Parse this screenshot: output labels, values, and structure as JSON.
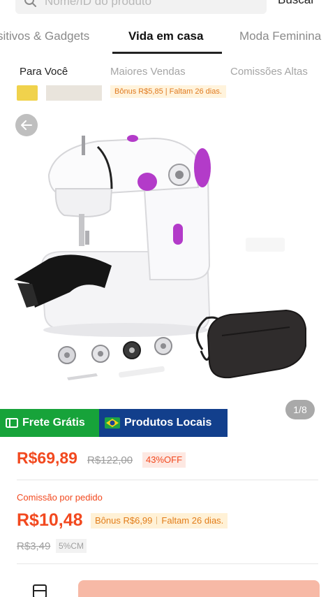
{
  "search": {
    "placeholder": "Nome/ID do produto",
    "button_label": "Buscar",
    "icon": "search-icon"
  },
  "category_tabs": [
    {
      "label": "Dispositivos & Gadgets",
      "visible_label": "sitivos & Gadgets",
      "active": false
    },
    {
      "label": "Vida em casa",
      "active": true
    },
    {
      "label": "Moda Feminina",
      "active": false
    }
  ],
  "sub_tabs": [
    {
      "label": "Para Você",
      "active": true
    },
    {
      "label": "Maiores Vendas",
      "active": false
    },
    {
      "label": "Comissões Altas",
      "active": false
    }
  ],
  "peek": {
    "bonus_text": "Bônus R$5,85 | Faltam 26 dias."
  },
  "product": {
    "image": "mini-sewing-machine-photo",
    "page_indicator": "1/8",
    "badges": {
      "free_shipping": "Frete Grátis",
      "local_products": "Produtos Locais"
    },
    "price": "R$69,89",
    "old_price": "R$122,00",
    "discount": "43%OFF"
  },
  "commission": {
    "label": "Comissão por pedido",
    "value": "R$10,48",
    "bonus": "Bônus R$6,99",
    "days_left": "Faltam 26 dias.",
    "old_value": "R$3,49",
    "rate": "5%CM"
  },
  "colors": {
    "accent": "#f2491f",
    "free_shipping_bg": "#17a33a",
    "local_products_bg": "#123f8c",
    "cta_bg": "#f7b9a6"
  }
}
